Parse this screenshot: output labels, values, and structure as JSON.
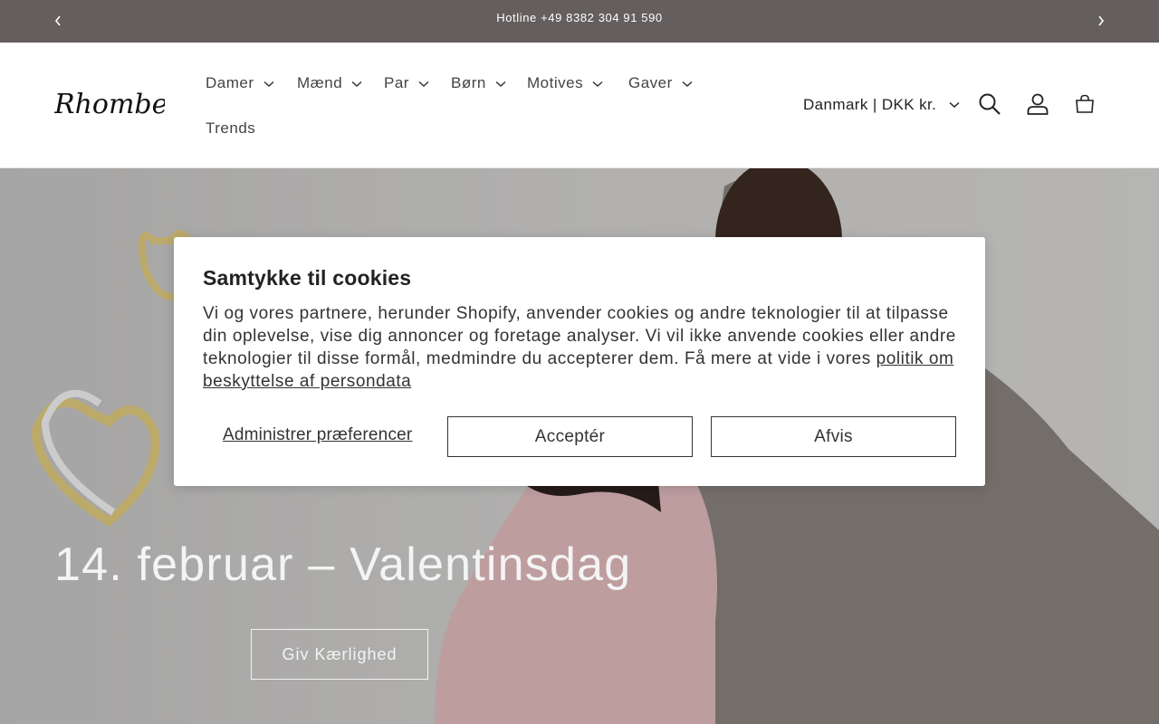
{
  "announcement": {
    "text": "Hotline +49 8382 304 91 590",
    "prev_icon": "chevron-left-icon",
    "next_icon": "chevron-right-icon"
  },
  "header": {
    "logo_text": "Rhomberg",
    "nav": [
      {
        "label": "Damer",
        "has_dropdown": true
      },
      {
        "label": "Mænd",
        "has_dropdown": true
      },
      {
        "label": "Par",
        "has_dropdown": true
      },
      {
        "label": "Børn",
        "has_dropdown": true
      },
      {
        "label": "Motives",
        "has_dropdown": true
      },
      {
        "label": "Gaver",
        "has_dropdown": true
      },
      {
        "label": "Trends",
        "has_dropdown": false
      }
    ],
    "country_selector": "Danmark | DKK kr.",
    "icons": [
      "search-icon",
      "account-icon",
      "cart-icon"
    ]
  },
  "hero": {
    "title": "14. februar – Valentinsdag",
    "button_label": "Giv Kærlighed"
  },
  "cookie_banner": {
    "title": "Samtykke til cookies",
    "body": "Vi og vores partnere, herunder Shopify, anvender cookies og andre teknologier til at tilpasse din oplevelse, vise dig annoncer og foretage analyser. Vi vil ikke anvende cookies eller andre teknologier til disse formål, medmindre du accepterer dem. Få mere at vide i vores ",
    "privacy_link": "politik om beskyttelse af persondata",
    "manage_label": "Administrer præferencer",
    "accept_label": "Acceptér",
    "reject_label": "Afvis"
  },
  "colors": {
    "announcement_bg": "#645e5e",
    "text": "#222222",
    "hero_text": "#f4f4f4"
  }
}
